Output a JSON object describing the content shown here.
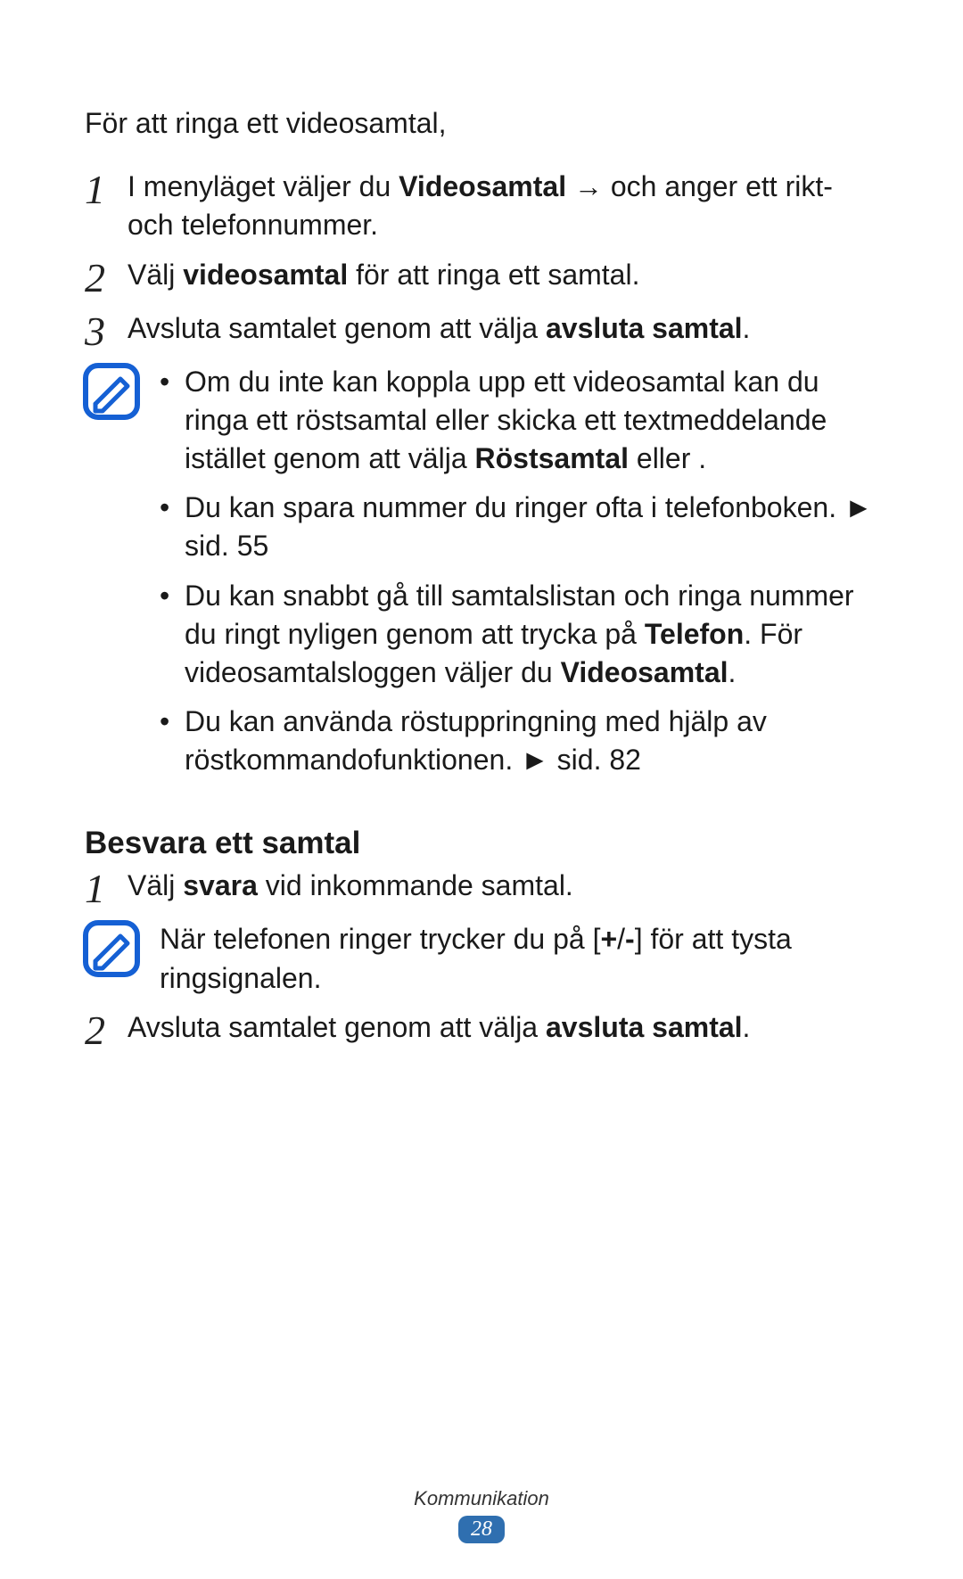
{
  "intro": "För att ringa ett videosamtal,",
  "section1": {
    "step1": {
      "num": "1",
      "pre": "I menyläget väljer du ",
      "bold1": "Videosamtal",
      "arrow": " → ",
      "post": " och anger ett rikt- och telefonnummer."
    },
    "step2": {
      "num": "2",
      "pre": "Välj ",
      "bold": "videosamtal",
      "post": " för att ringa ett samtal."
    },
    "step3": {
      "num": "3",
      "pre": "Avsluta samtalet genom att välja ",
      "bold": "avsluta samtal",
      "post": "."
    }
  },
  "note1": {
    "b1_pre": "Om du inte kan koppla upp ett videosamtal kan du ringa ett röstsamtal eller skicka ett textmeddelande istället genom att välja ",
    "b1_bold": "Röstsamtal",
    "b1_post": " eller      .",
    "b2": "Du kan spara nummer du ringer ofta i telefonboken. ► sid. 55",
    "b3_pre": "Du kan snabbt gå till samtalslistan och ringa nummer du ringt nyligen genom att trycka på ",
    "b3_bold1": "Telefon",
    "b3_mid": ". För videosamtalsloggen väljer du ",
    "b3_bold2": "Videosamtal",
    "b3_post": ".",
    "b4": "Du kan använda röstuppringning med hjälp av röstkommandofunktionen. ► sid. 82"
  },
  "subhead": "Besvara ett samtal",
  "section2": {
    "step1": {
      "num": "1",
      "pre": "Välj ",
      "bold": "svara",
      "post": " vid inkommande samtal."
    },
    "note_pre": "När telefonen ringer trycker du på [",
    "note_bold": "+",
    "note_mid": "/",
    "note_bold2": "-",
    "note_post": "] för att tysta ringsignalen.",
    "step2": {
      "num": "2",
      "pre": "Avsluta samtalet genom att välja ",
      "bold": "avsluta samtal",
      "post": "."
    }
  },
  "footer": {
    "section": "Kommunikation",
    "page": "28"
  }
}
